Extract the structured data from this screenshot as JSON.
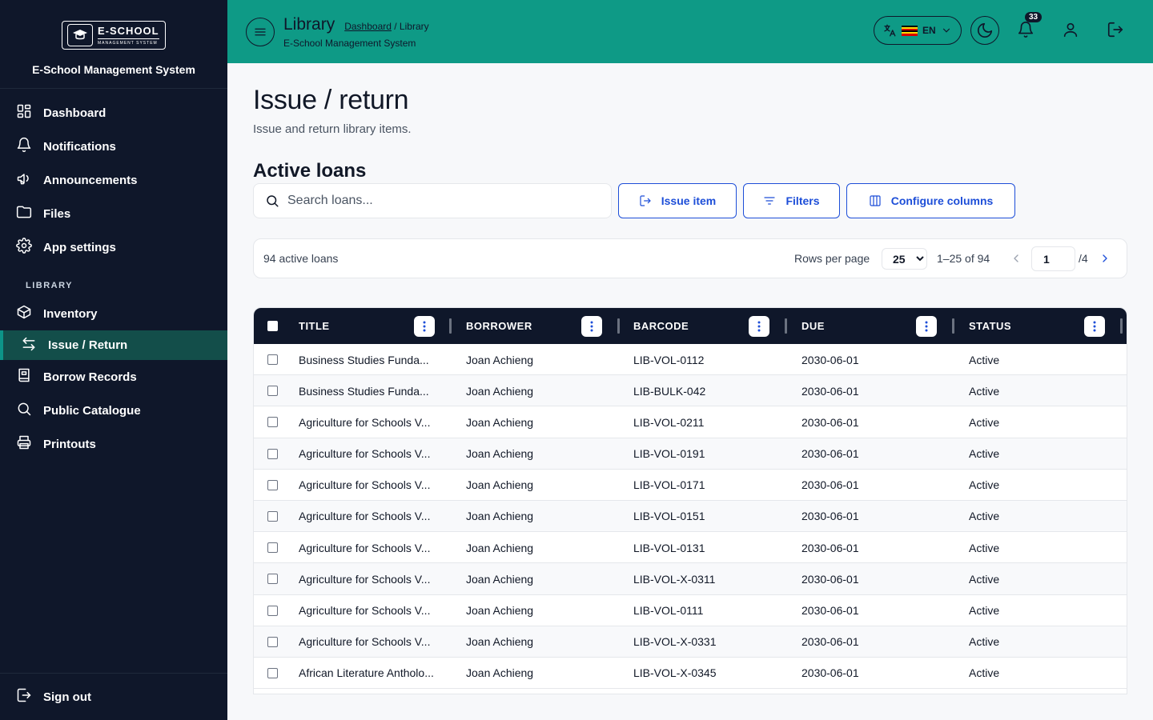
{
  "brand": {
    "logo_main": "E-SCHOOL",
    "logo_sub": "MANAGEMENT SYSTEM",
    "name": "E-School Management System"
  },
  "sidebar": {
    "items": [
      {
        "label": "Dashboard",
        "icon": "dashboard-icon"
      },
      {
        "label": "Notifications",
        "icon": "bell-icon"
      },
      {
        "label": "Announcements",
        "icon": "megaphone-icon"
      },
      {
        "label": "Files",
        "icon": "folder-icon"
      },
      {
        "label": "App settings",
        "icon": "gear-icon"
      }
    ],
    "section": "LIBRARY",
    "library_items": [
      {
        "label": "Inventory",
        "icon": "box-icon"
      },
      {
        "label": "Issue / Return",
        "icon": "swap-icon",
        "active": true
      },
      {
        "label": "Borrow Records",
        "icon": "book-icon"
      },
      {
        "label": "Public Catalogue",
        "icon": "search-icon"
      },
      {
        "label": "Printouts",
        "icon": "printer-icon"
      }
    ],
    "signout": "Sign out"
  },
  "header": {
    "title": "Library",
    "breadcrumb_link": "Dashboard",
    "breadcrumb_current": "/ Library",
    "subtitle": "E-School Management System",
    "lang": "EN",
    "notification_count": "33"
  },
  "page": {
    "title": "Issue / return",
    "subtitle": "Issue and return library items.",
    "section_title": "Active loans",
    "search_placeholder": "Search loans...",
    "buttons": {
      "issue": "Issue item",
      "filters": "Filters",
      "configure": "Configure columns"
    }
  },
  "pager": {
    "count": "94 active loans",
    "rows_label": "Rows per page",
    "rows_value": "25",
    "range": "1–25 of 94",
    "page": "1",
    "total": "/4"
  },
  "table": {
    "columns": [
      "TITLE",
      "BORROWER",
      "BARCODE",
      "DUE",
      "STATUS"
    ],
    "rows": [
      [
        "Business Studies Funda...",
        "Joan Achieng",
        "LIB-VOL-0112",
        "2030-06-01",
        "Active"
      ],
      [
        "Business Studies Funda...",
        "Joan Achieng",
        "LIB-BULK-042",
        "2030-06-01",
        "Active"
      ],
      [
        "Agriculture for Schools V...",
        "Joan Achieng",
        "LIB-VOL-0211",
        "2030-06-01",
        "Active"
      ],
      [
        "Agriculture for Schools V...",
        "Joan Achieng",
        "LIB-VOL-0191",
        "2030-06-01",
        "Active"
      ],
      [
        "Agriculture for Schools V...",
        "Joan Achieng",
        "LIB-VOL-0171",
        "2030-06-01",
        "Active"
      ],
      [
        "Agriculture for Schools V...",
        "Joan Achieng",
        "LIB-VOL-0151",
        "2030-06-01",
        "Active"
      ],
      [
        "Agriculture for Schools V...",
        "Joan Achieng",
        "LIB-VOL-0131",
        "2030-06-01",
        "Active"
      ],
      [
        "Agriculture for Schools V...",
        "Joan Achieng",
        "LIB-VOL-X-0311",
        "2030-06-01",
        "Active"
      ],
      [
        "Agriculture for Schools V...",
        "Joan Achieng",
        "LIB-VOL-0111",
        "2030-06-01",
        "Active"
      ],
      [
        "Agriculture for Schools V...",
        "Joan Achieng",
        "LIB-VOL-X-0331",
        "2030-06-01",
        "Active"
      ],
      [
        "African Literature Antholo...",
        "Joan Achieng",
        "LIB-VOL-X-0345",
        "2030-06-01",
        "Active"
      ]
    ]
  },
  "colors": {
    "sidebar_bg": "#0f172a",
    "header_bg": "#0e9a86",
    "accent": "#1d4ed8",
    "active_bg": "#134e4a"
  }
}
